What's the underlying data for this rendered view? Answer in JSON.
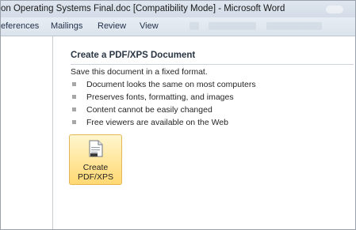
{
  "window": {
    "title": "on Operating Systems Final.doc [Compatibility Mode]  -  Microsoft Word"
  },
  "ribbon": {
    "tabs": [
      {
        "label": "eferences"
      },
      {
        "label": "Mailings"
      },
      {
        "label": "Review"
      },
      {
        "label": "View"
      }
    ]
  },
  "main": {
    "heading": "Create a PDF/XPS Document",
    "description": "Save this document in a fixed format.",
    "bullets": [
      "Document looks the same on most computers",
      "Preserves fonts, formatting, and images",
      "Content cannot be easily changed",
      "Free viewers are available on the Web"
    ],
    "create_button": {
      "line1": "Create",
      "line2": "PDF/XPS",
      "icon": "document-icon"
    }
  },
  "colors": {
    "accent_button": "#ffe69a",
    "button_border": "#e3b656",
    "ribbon_bg": "#dbe3ec"
  }
}
